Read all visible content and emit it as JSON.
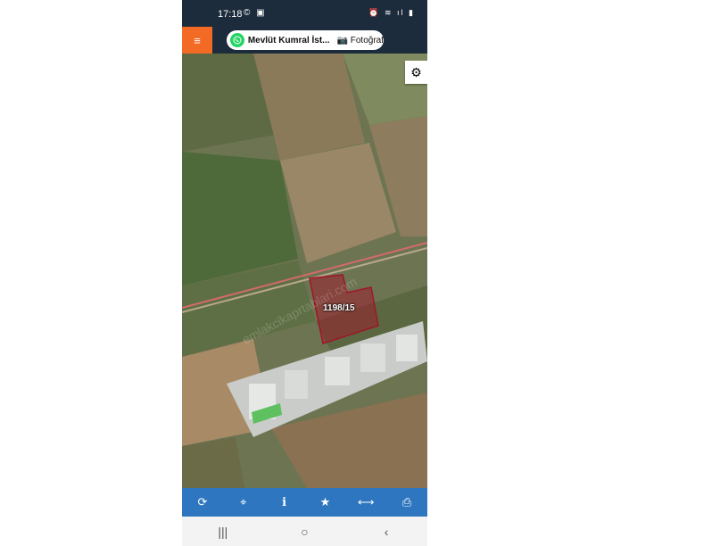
{
  "status_bar": {
    "time": "17:18",
    "left_icons": "© ▣",
    "right_icons": "⏰ ≋ ıl ▮"
  },
  "header": {
    "menu_icon": "≡",
    "contact_name": "Mevlüt Kumral İst...",
    "photo_label": "Fotoğraf",
    "photo_icon": "📷"
  },
  "map": {
    "parcel_label": "1198/15",
    "watermark": "emlakcikaprtablari.com",
    "settings_icon": "⚙"
  },
  "toolbar": {
    "items": [
      {
        "name": "refresh-icon",
        "glyph": "⟳"
      },
      {
        "name": "locate-icon",
        "glyph": "⌖"
      },
      {
        "name": "info-icon",
        "glyph": "i"
      },
      {
        "name": "star-icon",
        "glyph": "★"
      },
      {
        "name": "measure-icon",
        "glyph": "⟷"
      },
      {
        "name": "print-icon",
        "glyph": "⎙"
      }
    ]
  },
  "nav_bar": {
    "recents": "|||",
    "home": "○",
    "back": "‹"
  },
  "colors": {
    "accent": "#f36a24",
    "toolbar": "#2e77c0",
    "header": "#1d2c3c",
    "parcel": "#a0152a"
  }
}
